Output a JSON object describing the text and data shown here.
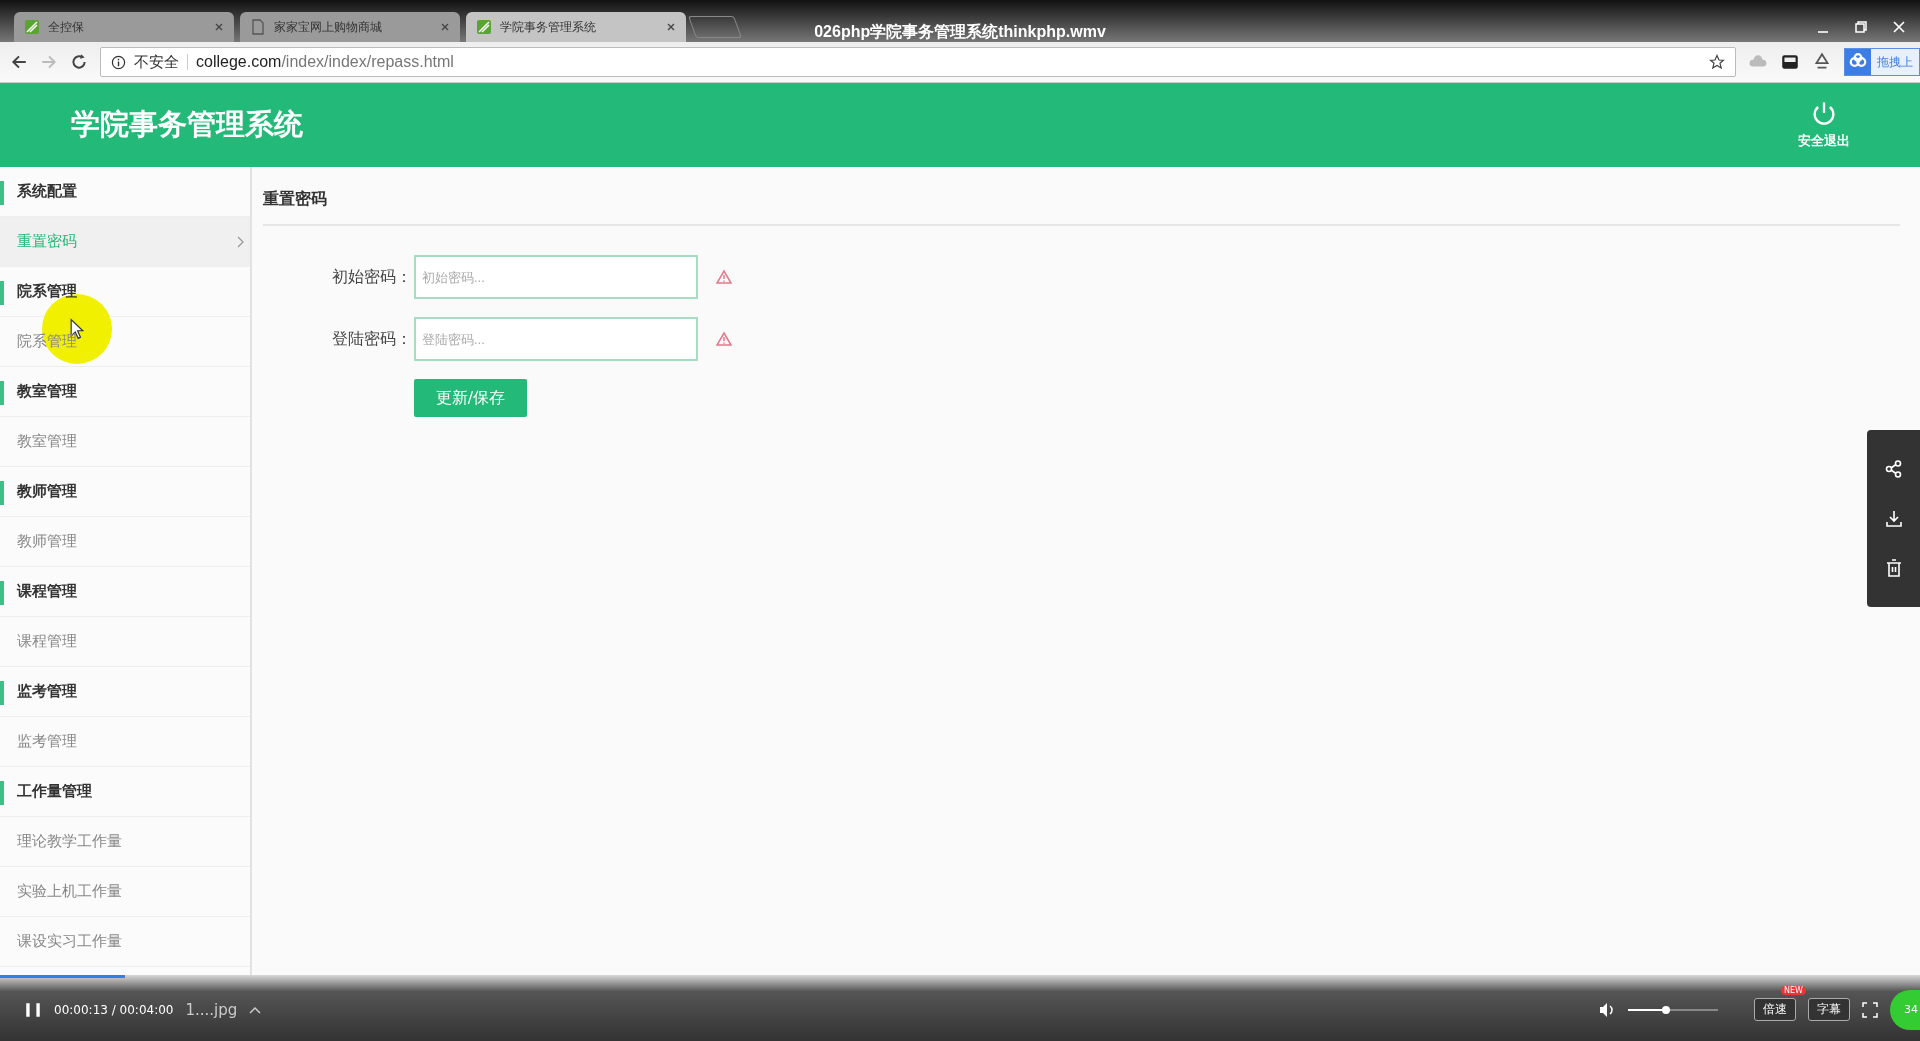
{
  "player": {
    "title": "026php学院事务管理系统thinkphp.wmv",
    "time": "00:00:13 / 00:04:00",
    "file": "1....jpg",
    "speed_button": "倍速",
    "speed_badge": "NEW",
    "subtitle_button": "字幕",
    "badge_count": "34",
    "progress": {
      "level": 0.065
    },
    "volume": {
      "level": 0.42
    }
  },
  "browser": {
    "tabs": [
      {
        "label": "全控保",
        "selected": false,
        "kind": "site"
      },
      {
        "label": "家家宝网上购物商城",
        "selected": false,
        "kind": "document"
      },
      {
        "label": "学院事务管理系统",
        "selected": true,
        "kind": "site"
      }
    ],
    "security": "不安全",
    "url_host": "college.com",
    "url_path": "/index/index/repass.html",
    "extension_button": "拖拽上"
  },
  "app": {
    "title": "学院事务管理系统",
    "logout": "安全退出"
  },
  "sidebar": [
    {
      "label": "系统配置",
      "kind": "group",
      "selected": false
    },
    {
      "label": "重置密码",
      "kind": "item",
      "selected": true
    },
    {
      "label": "院系管理",
      "kind": "group",
      "selected": false
    },
    {
      "label": "院系管理",
      "kind": "item",
      "selected": false
    },
    {
      "label": "教室管理",
      "kind": "group",
      "selected": false
    },
    {
      "label": "教室管理",
      "kind": "item",
      "selected": false
    },
    {
      "label": "教师管理",
      "kind": "group",
      "selected": false
    },
    {
      "label": "教师管理",
      "kind": "item",
      "selected": false
    },
    {
      "label": "课程管理",
      "kind": "group",
      "selected": false
    },
    {
      "label": "课程管理",
      "kind": "item",
      "selected": false
    },
    {
      "label": "监考管理",
      "kind": "group",
      "selected": false
    },
    {
      "label": "监考管理",
      "kind": "item",
      "selected": false
    },
    {
      "label": "工作量管理",
      "kind": "group",
      "selected": false
    },
    {
      "label": "理论教学工作量",
      "kind": "item",
      "selected": false
    },
    {
      "label": "实验上机工作量",
      "kind": "item",
      "selected": false
    },
    {
      "label": "课设实习工作量",
      "kind": "item",
      "selected": false
    }
  ],
  "form": {
    "title": "重置密码",
    "fields": [
      {
        "label": "初始密码：",
        "placeholder": "初始密码..."
      },
      {
        "label": "登陆密码：",
        "placeholder": "登陆密码..."
      }
    ],
    "submit": "更新/保存"
  }
}
